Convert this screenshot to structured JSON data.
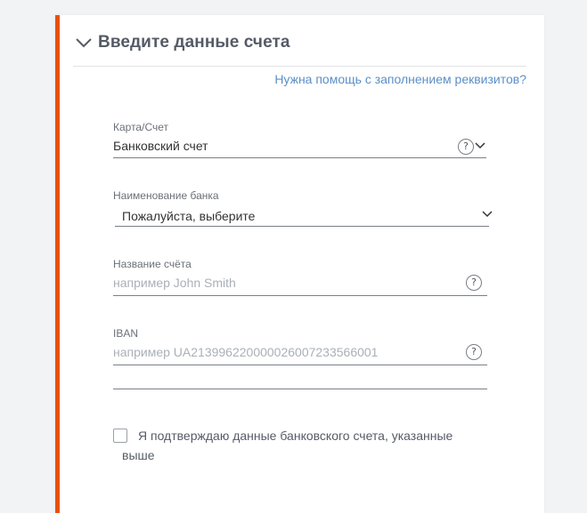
{
  "section": {
    "title": "Введите данные счета",
    "help_link": "Нужна помощь с заполнением реквизитов?"
  },
  "fields": {
    "card_account": {
      "label": "Карта/Счет",
      "value": "Банковский счет"
    },
    "bank_name": {
      "label": "Наименование банка",
      "value": "Пожалуйста, выберите"
    },
    "account_name": {
      "label": "Название счёта",
      "placeholder": "например John Smith"
    },
    "iban": {
      "label": "IBAN",
      "placeholder": "например UA213996220000026007233566001"
    }
  },
  "confirm": {
    "label": "Я подтверждаю данные банковского счета, указанные выше",
    "checked": false
  },
  "icons": {
    "collapse": "chevron-down-icon",
    "help": "question-mark-icon",
    "dropdown": "chevron-down-icon"
  },
  "colors": {
    "accent": "#e8500f",
    "link": "#5b8fc7",
    "title": "#555b66",
    "background": "#f2f3f5"
  }
}
